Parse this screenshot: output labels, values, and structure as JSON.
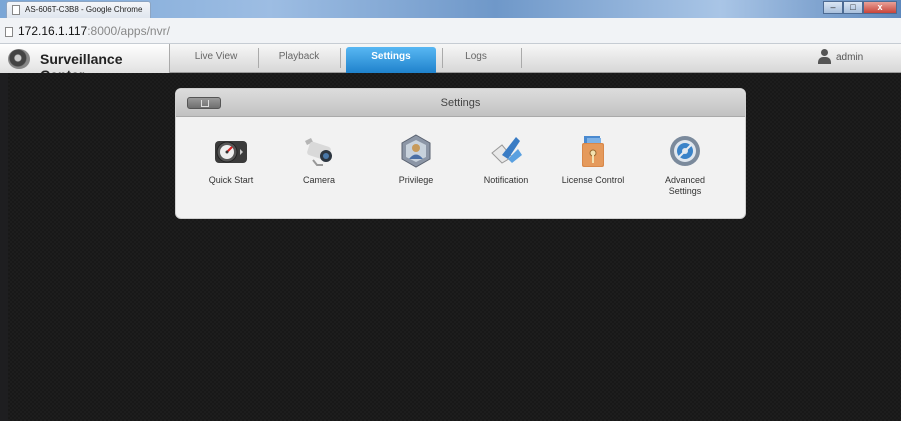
{
  "browser": {
    "tab_title": "AS-606T-C3B8 - Google Chrome",
    "window_controls": {
      "minimize": "–",
      "maximize": "□",
      "close": "x"
    },
    "url_host": "172.16.1.117",
    "url_rest": ":8000/apps/nvr/"
  },
  "app": {
    "brand_title": "Surveillance Center",
    "nav": [
      {
        "label": "Live View"
      },
      {
        "label": "Playback"
      },
      {
        "label": "Settings",
        "active": true
      },
      {
        "label": "Logs"
      }
    ],
    "user": "admin"
  },
  "settings_panel": {
    "title": "Settings",
    "items": [
      {
        "label": "Quick Start",
        "icon": "gauge-icon"
      },
      {
        "label": "Camera",
        "icon": "camera-icon"
      },
      {
        "label": "Privilege",
        "icon": "privilege-icon"
      },
      {
        "label": "Notification",
        "icon": "notification-icon"
      },
      {
        "label": "License Control",
        "icon": "license-icon"
      },
      {
        "label": "Advanced\nSettings",
        "icon": "advanced-settings-icon"
      }
    ]
  },
  "colors": {
    "active_tab": "#1f82cc",
    "background": "#181818",
    "panel": "#f2f2f2"
  }
}
